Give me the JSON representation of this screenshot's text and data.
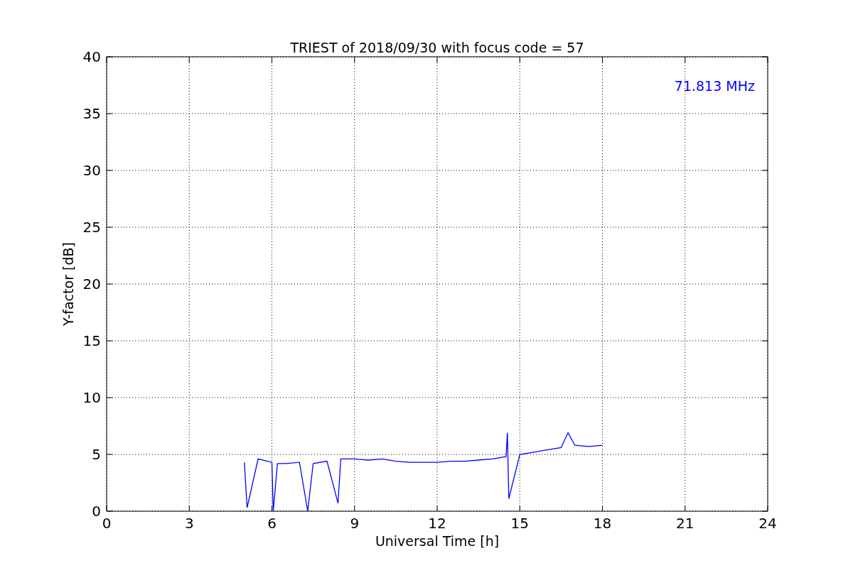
{
  "chart_data": {
    "type": "line",
    "title": "TRIEST of 2018/09/30 with focus code = 57",
    "xlabel": "Universal Time [h]",
    "ylabel": "Y-factor [dB]",
    "x": [
      5,
      5.1,
      5.5,
      6,
      6.05,
      6.2,
      6.5,
      7,
      7.3,
      7.5,
      8,
      8.4,
      8.5,
      9,
      9.5,
      10,
      10.5,
      11,
      11.5,
      12,
      12.5,
      13,
      13.5,
      14,
      14.5,
      14.55,
      14.6,
      15,
      15.5,
      16,
      16.5,
      16.75,
      17,
      17.5,
      18
    ],
    "series": [
      {
        "name": "71.813 MHz",
        "color": "#0000ff",
        "values": [
          4.3,
          0.3,
          4.6,
          4.3,
          0,
          4.2,
          4.2,
          4.3,
          0,
          4.2,
          4.4,
          0.7,
          4.6,
          4.6,
          4.5,
          4.6,
          4.4,
          4.3,
          4.3,
          4.3,
          4.4,
          4.4,
          4.5,
          4.6,
          4.8,
          6.9,
          1.1,
          5.0,
          5.2,
          5.4,
          5.6,
          6.9,
          5.8,
          5.7,
          5.8
        ]
      }
    ],
    "xlim": [
      0,
      24
    ],
    "ylim": [
      0,
      40
    ],
    "xticks": [
      0,
      3,
      6,
      9,
      12,
      15,
      18,
      21,
      24
    ],
    "yticks": [
      0,
      5,
      10,
      15,
      20,
      25,
      30,
      35,
      40
    ],
    "grid": true
  }
}
